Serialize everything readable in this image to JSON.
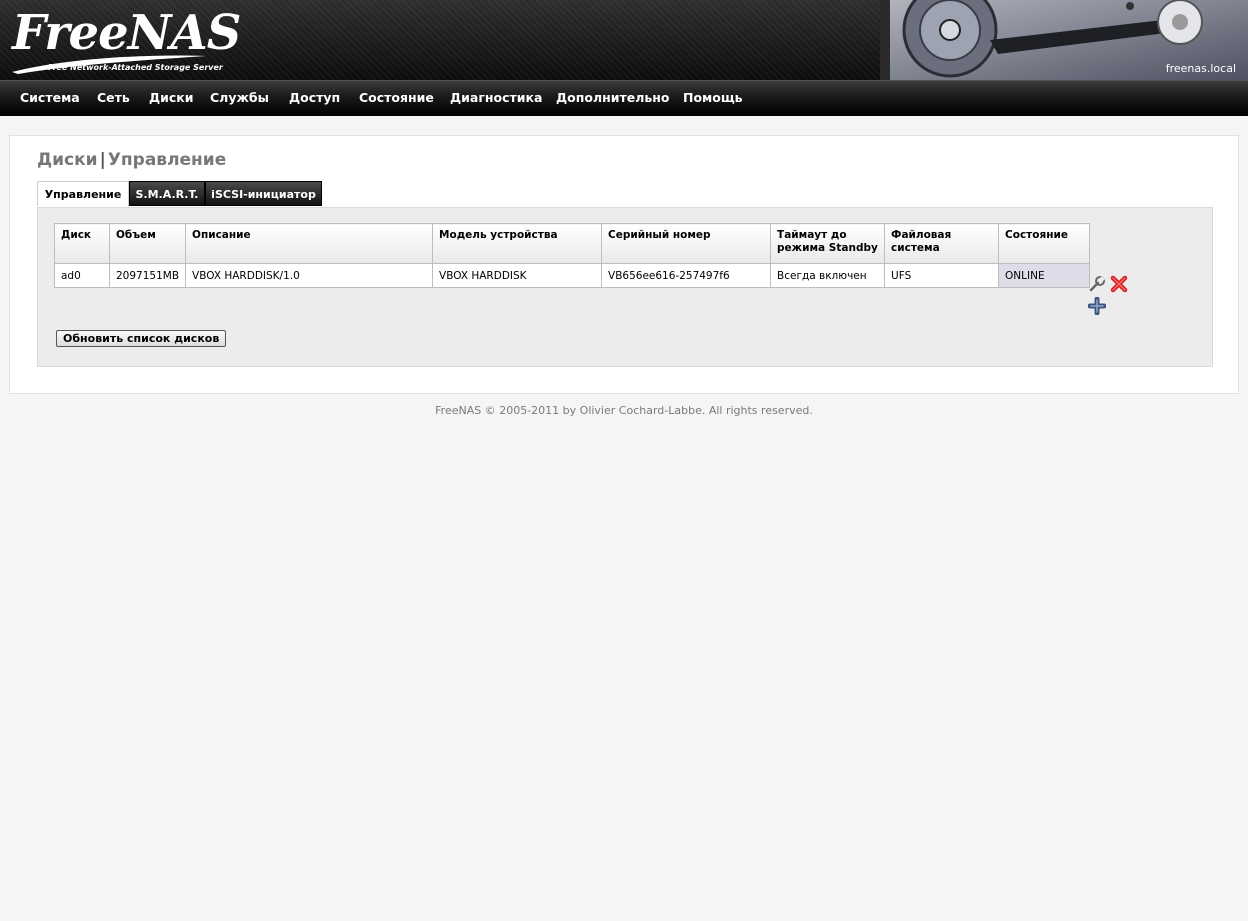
{
  "header": {
    "logo_text": "FreeNAS",
    "tagline": "Free Network-Attached Storage Server",
    "hostname": "freenas.local"
  },
  "nav": {
    "items": [
      "Система",
      "Сеть",
      "Диски",
      "Службы",
      "Доступ",
      "Состояние",
      "Диагностика",
      "Дополнительно",
      "Помощь"
    ]
  },
  "page": {
    "title_section": "Диски",
    "title_separator": "|",
    "title_page": "Управление"
  },
  "tabs": [
    {
      "label": "Управление",
      "active": true
    },
    {
      "label": "S.M.A.R.T.",
      "active": false
    },
    {
      "label": "iSCSI-инициатор",
      "active": false
    }
  ],
  "table": {
    "columns": [
      "Диск",
      "Объем",
      "Описание",
      "Модель устройства",
      "Серийный номер",
      "Таймаут до режима Standby",
      "Файловая система",
      "Состояние"
    ],
    "rows": [
      [
        "ad0",
        "2097151MB",
        "VBOX HARDDISK/1.0",
        "VBOX HARDDISK",
        "VB656ee616-257497f6",
        "Всегда включен",
        "UFS",
        "ONLINE"
      ]
    ]
  },
  "actions": {
    "edit_icon": "wrench-icon",
    "delete_icon": "delete-x-icon",
    "add_icon": "plus-icon"
  },
  "buttons": {
    "refresh_label": "Обновить список дисков"
  },
  "footer": {
    "text": "FreeNAS © 2005-2011 by Olivier Cochard-Labbe. All rights reserved."
  },
  "colors": {
    "header_bg": "#1a1a1a",
    "status_cell_bg": "#dcdde8",
    "page_bg": "#f5f5f5",
    "delete_red": "#d32020",
    "add_blue": "#4a6a9a"
  }
}
